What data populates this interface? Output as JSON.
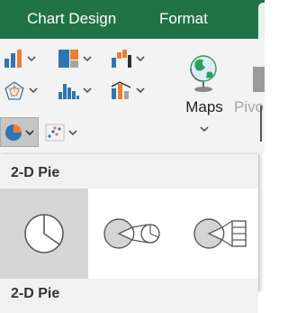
{
  "tabs": [
    {
      "label": "Chart Design"
    },
    {
      "label": "Format"
    }
  ],
  "ribbon": {
    "maps_label": "Maps",
    "pivot_label": "Pivo"
  },
  "gallery": {
    "section_2d_pie": "2-D Pie",
    "section_next": "2-D Pie",
    "items": [
      {
        "icon": "pie-chart-icon",
        "selected": true
      },
      {
        "icon": "pie-of-pie-icon",
        "selected": false
      },
      {
        "icon": "bar-of-pie-icon",
        "selected": false
      }
    ]
  },
  "colors": {
    "ribbon_tab_green": "#217346",
    "icon_blue": "#2e75b6",
    "icon_green": "#2f9e5b",
    "icon_orange": "#ed7d31",
    "icon_dark": "#2f2f2f"
  }
}
